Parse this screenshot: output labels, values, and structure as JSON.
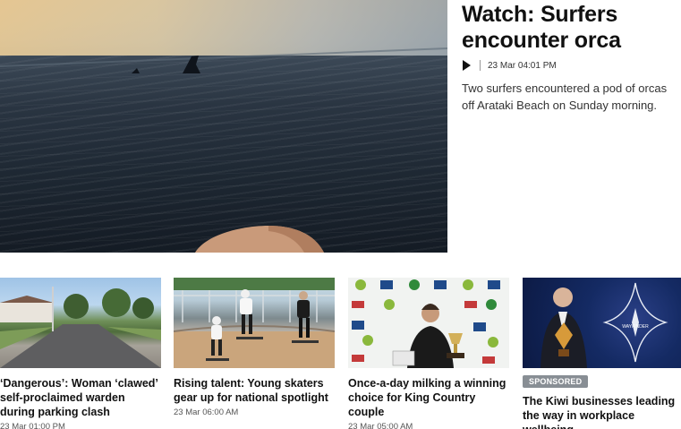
{
  "hero": {
    "title": "Watch: Surfers encounter orca",
    "date": "23 Mar 04:01 PM",
    "description": "Two surfers encountered a pod of orcas off Arataki Beach on Sunday morning."
  },
  "cards": [
    {
      "title": "‘Dangerous’: Woman ‘clawed’ self-proclaimed warden during parking clash",
      "date": "23 Mar 01:00 PM"
    },
    {
      "title": "Rising talent: Young skaters gear up for national spotlight",
      "date": "23 Mar 06:00 AM"
    },
    {
      "title": "Once-a-day milking a winning choice for King Country couple",
      "date": "23 Mar 05:00 AM"
    },
    {
      "badge": "SPONSORED",
      "title": "The Kiwi businesses leading the way in workplace wellbeing",
      "logo_text": "WAYFINDER"
    }
  ],
  "icons": {
    "play": "play-icon"
  }
}
